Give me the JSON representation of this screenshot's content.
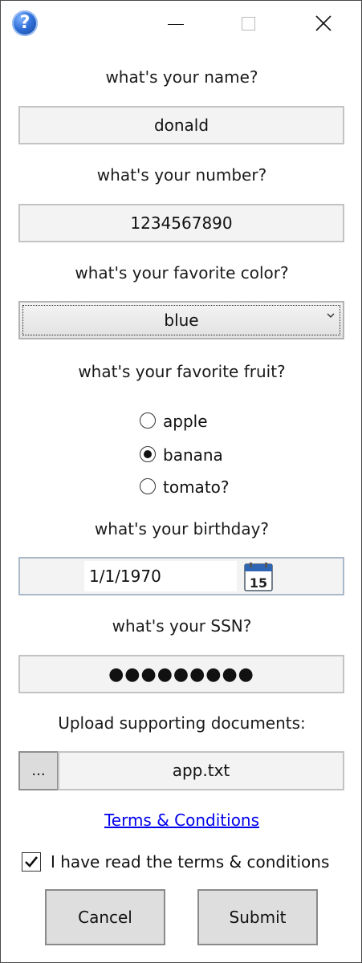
{
  "window": {
    "help_icon_glyph": "?",
    "close_glyph": "close-icon"
  },
  "name": {
    "label": "what's your name?",
    "value": "donald"
  },
  "number": {
    "label": "what's your number?",
    "value": "1234567890"
  },
  "color": {
    "label": "what's your favorite color?",
    "selected": "blue"
  },
  "fruit": {
    "label": "what's your favorite fruit?",
    "options": [
      "apple",
      "banana",
      "tomato?"
    ],
    "selected_index": 1
  },
  "birthday": {
    "label": "what's your birthday?",
    "value": "1/1/1970",
    "calendar_day": "15"
  },
  "ssn": {
    "label": "what's your SSN?",
    "masked_value": "●●●●●●●●●"
  },
  "upload": {
    "label": "Upload supporting documents:",
    "browse_label": "...",
    "file_name": "app.txt"
  },
  "terms": {
    "link_text": "Terms & Conditions",
    "checkbox_label": "I have read the terms & conditions",
    "checked": true
  },
  "actions": {
    "cancel_label": "Cancel",
    "submit_label": "Submit"
  },
  "colors": {
    "link": "#0000ee",
    "field_bg": "#f3f3f3",
    "button_bg": "#dedede",
    "help_icon_blue": "#2f6fd8"
  }
}
